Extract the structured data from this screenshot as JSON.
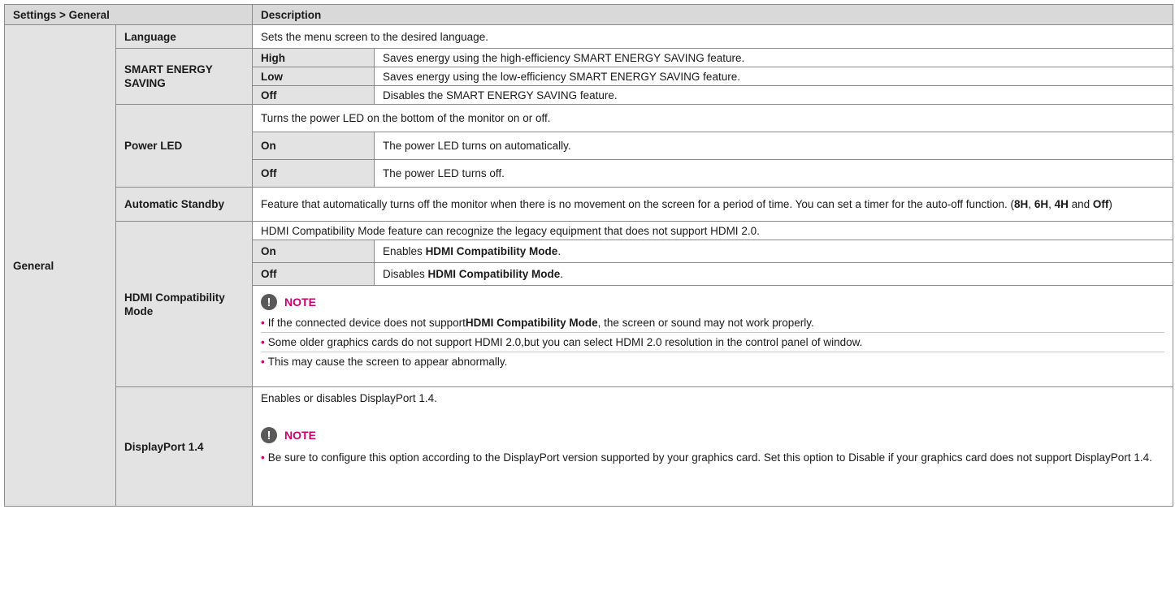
{
  "header": {
    "col1": "Settings > General",
    "col2": "Description"
  },
  "section": "General",
  "language": {
    "label": "Language",
    "desc": "Sets the menu screen to the desired language."
  },
  "smart_energy": {
    "label": "SMART ENERGY SAVING",
    "options": [
      {
        "name": "High",
        "desc": "Saves energy using the high-efficiency SMART ENERGY SAVING feature."
      },
      {
        "name": "Low",
        "desc": "Saves energy using the low-efficiency SMART ENERGY SAVING feature."
      },
      {
        "name": "Off",
        "desc": "Disables the SMART ENERGY SAVING feature."
      }
    ]
  },
  "power_led": {
    "label": "Power LED",
    "intro": "Turns the power LED on the bottom of the monitor on or off.",
    "options": [
      {
        "name": "On",
        "desc": "The power LED turns on automatically."
      },
      {
        "name": "Off",
        "desc": "The power LED turns off."
      }
    ]
  },
  "auto_standby": {
    "label": "Automatic Standby",
    "desc_main": "Feature that automatically turns off the monitor when there is no movement on the screen for a period of time. You can set a timer for the auto-off function. (",
    "v1": "8H",
    "sep1": ", ",
    "v2": "6H",
    "sep2": ", ",
    "v3": "4H",
    "and": " and ",
    "v4": "Off",
    "close": ")"
  },
  "hdmi": {
    "label": "HDMI Compatibility Mode",
    "intro": "HDMI Compatibility Mode feature can recognize the legacy equipment that does not support HDMI 2.0.",
    "on_name": "On",
    "on_pre": "Enables ",
    "on_bold": "HDMI Compatibility Mode",
    "on_post": ".",
    "off_name": "Off",
    "off_pre": "Disables ",
    "off_bold": "HDMI Compatibility Mode",
    "off_post": ".",
    "note_label": "NOTE",
    "note1_pre": "If the connected device does not support ",
    "note1_bold": "HDMI Compatibility Mode",
    "note1_post": ", the screen or sound may not work properly.",
    "note2": "Some older graphics cards do not support HDMI 2.0,but you can select HDMI 2.0 resolution in the control panel of window.",
    "note3": "This may cause the screen to appear abnormally."
  },
  "displayport": {
    "label": "DisplayPort 1.4",
    "intro": "Enables or disables DisplayPort 1.4.",
    "note_label": "NOTE",
    "note1": "Be sure to configure this option according to the DisplayPort version supported by your graphics card. Set this option to Disable if your graphics card does not support DisplayPort 1.4."
  },
  "icons": {
    "note": "exclamation-circle-icon",
    "bullet": "•"
  },
  "colors": {
    "accent": "#c8006c",
    "header_bg": "#d9d9d9",
    "label_bg": "#e3e3e3",
    "icon_bg": "#595959"
  }
}
